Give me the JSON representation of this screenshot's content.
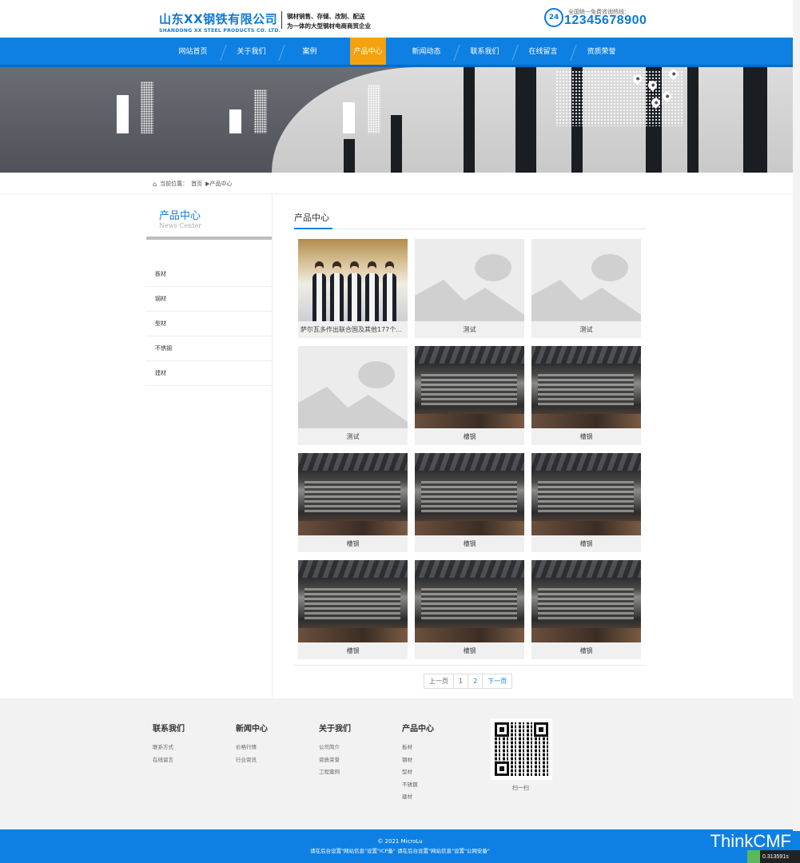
{
  "header": {
    "company_cn": "山东XX钢铁有限公司",
    "company_en": "SHANDONG XX STEEL PRODUCTS CO. LTD.",
    "slogan_line1": "钢材销售、存储、改制、配送",
    "slogan_line2": "为一体的大型钢材电商商贸企业",
    "hotline_badge": "24",
    "hotline_label": "全国统一免费咨询热线：",
    "hotline_number": "12345678900"
  },
  "nav": {
    "items": [
      "网站首页",
      "关于我们",
      "案例",
      "产品中心",
      "新闻动态",
      "联系我们",
      "在线留言",
      "资质荣誉"
    ],
    "active_index": 3
  },
  "breadcrumb": {
    "label": "当前位置：",
    "home": "首页",
    "separator": "▶",
    "current": "产品中心"
  },
  "sidebar": {
    "title": "产品中心",
    "subtitle": "News Center",
    "items": [
      "板材",
      "钢材",
      "型材",
      "不锈钢",
      "建材"
    ]
  },
  "content": {
    "title": "产品中心",
    "products": [
      {
        "caption": "萨尔瓦多作出联合国及其他177个...",
        "image": "people"
      },
      {
        "caption": "测试",
        "image": "placeholder"
      },
      {
        "caption": "测试",
        "image": "placeholder"
      },
      {
        "caption": "测试",
        "image": "placeholder"
      },
      {
        "caption": "槽钢",
        "image": "steel"
      },
      {
        "caption": "槽钢",
        "image": "steel"
      },
      {
        "caption": "槽钢",
        "image": "steel"
      },
      {
        "caption": "槽钢",
        "image": "steel"
      },
      {
        "caption": "槽钢",
        "image": "steel"
      },
      {
        "caption": "槽钢",
        "image": "steel"
      },
      {
        "caption": "槽钢",
        "image": "steel"
      },
      {
        "caption": "槽钢",
        "image": "steel"
      }
    ]
  },
  "pagination": {
    "prev": "上一页",
    "pages": [
      "1",
      "2"
    ],
    "next": "下一页"
  },
  "footer": {
    "columns": [
      {
        "title": "联系我们",
        "links": [
          "联系方式",
          "在线留言"
        ]
      },
      {
        "title": "新闻中心",
        "links": [
          "价格行情",
          "行业资讯"
        ]
      },
      {
        "title": "关于我们",
        "links": [
          "公司简介",
          "资质荣誉",
          "工程案例"
        ]
      },
      {
        "title": "产品中心",
        "links": [
          "板材",
          "钢材",
          "型材",
          "不锈钢",
          "建材"
        ]
      }
    ],
    "qr_label": "扫一扫",
    "copyright": "© 2021 MicroLu",
    "icp": "请在后台设置\"网站信息\"设置\"ICP备\" 请在后台设置\"网站信息\"设置\"公网安备\""
  },
  "framework": {
    "brand": "ThinkCMF",
    "timer": "0.313591s"
  },
  "colors": {
    "primary": "#0e80e3",
    "active_nav": "#f4a20e"
  }
}
